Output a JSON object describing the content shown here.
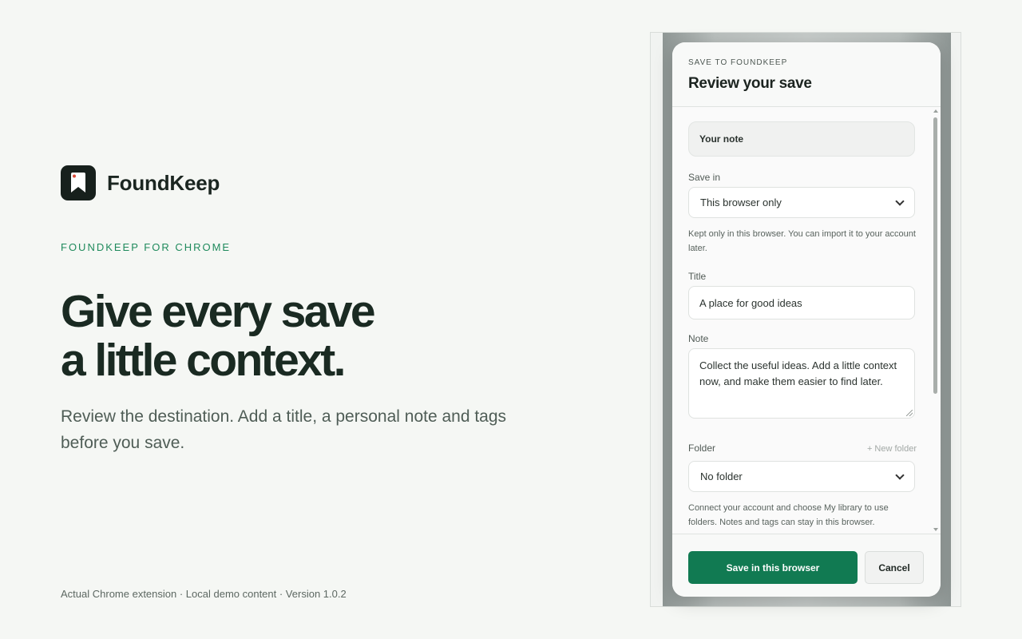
{
  "brand": {
    "name": "FoundKeep",
    "logo_icon": "bookmark-icon"
  },
  "hero": {
    "eyebrow": "FOUNDKEEP FOR CHROME",
    "headline_line1": "Give every save",
    "headline_line2": "a little context.",
    "subline": "Review the destination. Add a title, a personal note and tags before you save."
  },
  "footer_note": "Actual Chrome extension · Local demo content · Version 1.0.2",
  "popup": {
    "eyebrow": "SAVE TO FOUNDKEEP",
    "title": "Review your save",
    "note_chip": "Your note",
    "save_in": {
      "label": "Save in",
      "value": "This browser only",
      "hint": "Kept only in this browser. You can import it to your account later."
    },
    "title_field": {
      "label": "Title",
      "value": "A place for good ideas"
    },
    "note_field": {
      "label": "Note",
      "value": "Collect the useful ideas. Add a little context now, and make them easier to find later."
    },
    "folder": {
      "label": "Folder",
      "new_folder_link": "+ New folder",
      "value": "No folder",
      "hint": "Connect your account and choose My library to use folders. Notes and tags can stay in this browser."
    },
    "actions": {
      "primary": "Save in this browser",
      "cancel": "Cancel"
    }
  },
  "colors": {
    "accent": "#117a52",
    "eyebrow": "#1f8a5c",
    "background": "#f5f7f4"
  }
}
